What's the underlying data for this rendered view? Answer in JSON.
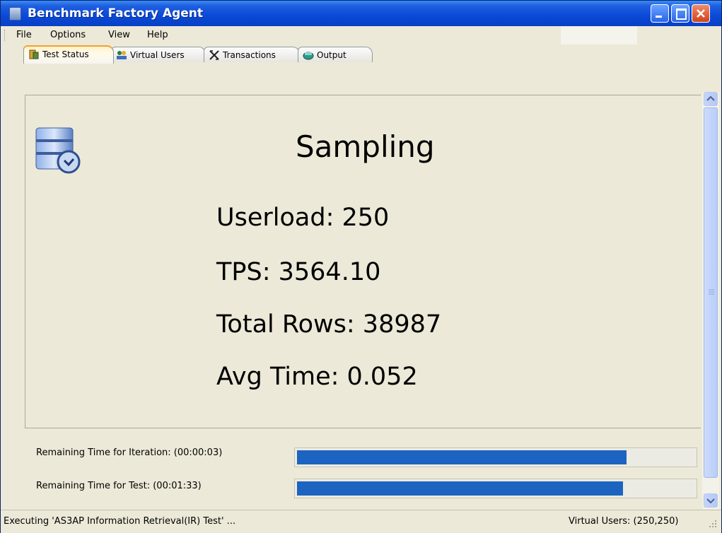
{
  "window": {
    "title": "Benchmark Factory Agent"
  },
  "menu": {
    "items": [
      "File",
      "Options",
      "View",
      "Help"
    ]
  },
  "tabs": [
    {
      "label": "Test Status",
      "icon": "test-status-icon",
      "active": true
    },
    {
      "label": "Virtual Users",
      "icon": "virtual-users-icon",
      "active": false
    },
    {
      "label": "Transactions",
      "icon": "transactions-icon",
      "active": false
    },
    {
      "label": "Output",
      "icon": "output-icon",
      "active": false
    }
  ],
  "status": {
    "state": "Sampling",
    "userload": "Userload: 250",
    "tps": "TPS: 3564.10",
    "total_rows": "Total Rows: 38987",
    "avg_time": "Avg Time: 0.052"
  },
  "progress": [
    {
      "label": "Remaining Time for Iteration: (00:00:03)",
      "fraction": 0.83
    },
    {
      "label": "Remaining Time for Test: (00:01:33)",
      "fraction": 0.82
    }
  ],
  "statusbar": {
    "left": "Executing 'AS3AP Information Retrieval(IR) Test' ...",
    "right": "Virtual Users: (250,250)"
  },
  "colors": {
    "progress_fill": "#1c64bf",
    "titlebar": "#0a49d6",
    "active_tab_accent": "#f0a030"
  }
}
